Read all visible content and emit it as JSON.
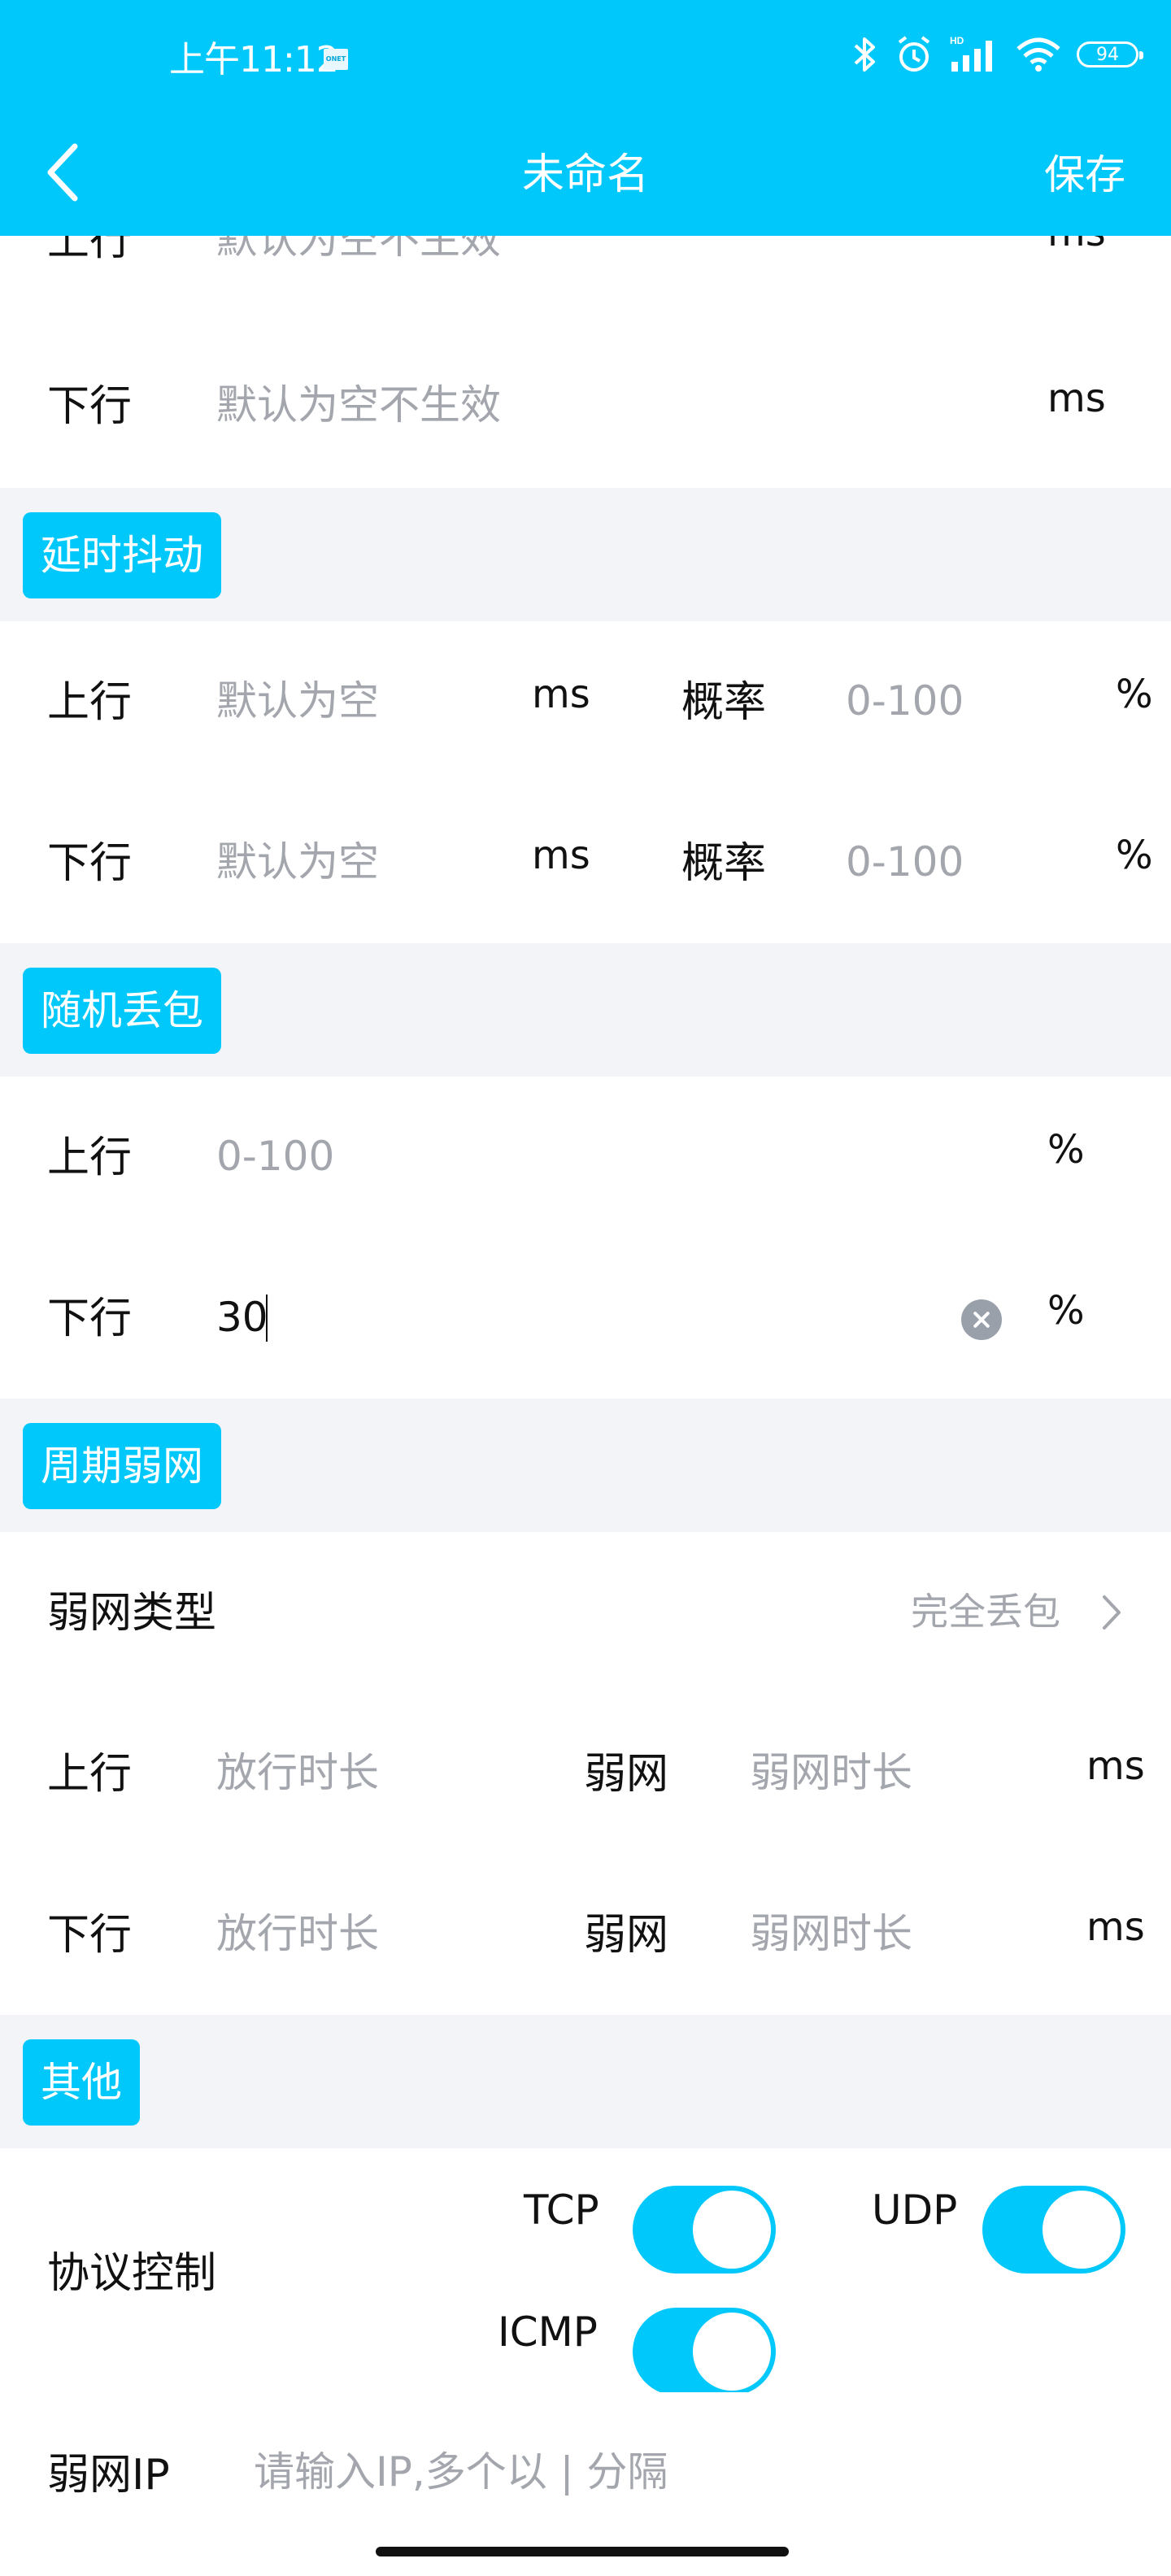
{
  "status_bar": {
    "time": "上午11:12",
    "badge": "ONET",
    "icons": [
      "bluetooth-icon",
      "alarm-icon",
      "signal-icon",
      "wifi-icon",
      "battery-icon"
    ],
    "hd_label": "HD",
    "battery_level": "94"
  },
  "header": {
    "title": "未命名",
    "save_label": "保存",
    "back_icon": "chevron-left-icon",
    "color": "#00c8fb"
  },
  "latency": {
    "up": {
      "label": "上行",
      "placeholder": "默认为空不生效",
      "unit": "ms"
    },
    "down": {
      "label": "下行",
      "placeholder": "默认为空不生效",
      "unit": "ms"
    }
  },
  "jitter": {
    "title": "延时抖动",
    "up": {
      "label": "上行",
      "placeholder": "默认为空",
      "unit": "ms",
      "prob_label": "概率",
      "prob_placeholder": "0-100",
      "prob_unit": "%"
    },
    "down": {
      "label": "下行",
      "placeholder": "默认为空",
      "unit": "ms",
      "prob_label": "概率",
      "prob_placeholder": "0-100",
      "prob_unit": "%"
    }
  },
  "loss": {
    "title": "随机丢包",
    "up": {
      "label": "上行",
      "placeholder": "0-100",
      "unit": "%"
    },
    "down": {
      "label": "下行",
      "value": "30",
      "unit": "%"
    }
  },
  "periodic": {
    "title": "周期弱网",
    "type_label": "弱网类型",
    "type_value": "完全丢包",
    "up": {
      "label": "上行",
      "pass_placeholder": "放行时长",
      "weak_label": "弱网",
      "weak_placeholder": "弱网时长",
      "unit": "ms"
    },
    "down": {
      "label": "下行",
      "pass_placeholder": "放行时长",
      "weak_label": "弱网",
      "weak_placeholder": "弱网时长",
      "unit": "ms"
    }
  },
  "other": {
    "title": "其他",
    "protocol_label": "协议控制",
    "protocols": [
      {
        "name": "TCP",
        "on": true
      },
      {
        "name": "UDP",
        "on": true
      },
      {
        "name": "ICMP",
        "on": true
      }
    ],
    "ip_label": "弱网IP",
    "ip_placeholder": "请输入IP,多个以 | 分隔"
  }
}
